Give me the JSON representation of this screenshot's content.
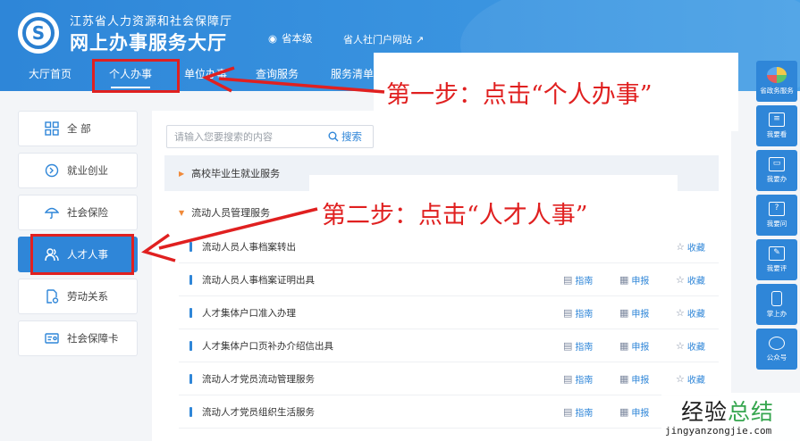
{
  "header": {
    "org_name": "江苏省人力资源和社会保障厅",
    "site_title": "网上办事服务大厅",
    "location": "省本级",
    "portal_link": "省人社门户网站"
  },
  "nav": {
    "items": [
      {
        "label": "大厅首页"
      },
      {
        "label": "个人办事"
      },
      {
        "label": "单位办事"
      },
      {
        "label": "查询服务"
      },
      {
        "label": "服务清单"
      }
    ]
  },
  "sidebar": {
    "items": [
      {
        "label": "全 部"
      },
      {
        "label": "就业创业"
      },
      {
        "label": "社会保险"
      },
      {
        "label": "人才人事"
      },
      {
        "label": "劳动关系"
      },
      {
        "label": "社会保障卡"
      }
    ]
  },
  "search": {
    "placeholder": "请输入您要搜索的内容",
    "button_label": "搜索"
  },
  "categories": [
    {
      "label": "高校毕业生就业服务"
    },
    {
      "label": "流动人员管理服务"
    }
  ],
  "services": [
    {
      "name": "流动人员人事档案转出",
      "fav": "收藏"
    },
    {
      "name": "流动人员人事档案证明出具",
      "guide": "指南",
      "report": "申报",
      "fav": "收藏"
    },
    {
      "name": "人才集体户口准入办理",
      "guide": "指南",
      "report": "申报",
      "fav": "收藏"
    },
    {
      "name": "人才集体户口页补办介绍信出具",
      "guide": "指南",
      "report": "申报",
      "fav": "收藏"
    },
    {
      "name": "流动人才党员流动管理服务",
      "guide": "指南",
      "report": "申报",
      "fav": "收藏"
    },
    {
      "name": "流动人才党员组织生活服务",
      "guide": "指南",
      "report": "申报"
    }
  ],
  "rightbar": {
    "items": [
      {
        "label": "省政务服务"
      },
      {
        "label": "我要看"
      },
      {
        "label": "我要办"
      },
      {
        "label": "我要问"
      },
      {
        "label": "我要评"
      },
      {
        "label": "掌上办"
      },
      {
        "label": "公众号"
      }
    ]
  },
  "annotations": {
    "step1": "第一步：点击“个人办事”",
    "step2": "第二步：点击“人才人事”",
    "color": "#e02020"
  },
  "watermark": {
    "title_black": "经验",
    "title_green": "总结",
    "url": "jingyanzongjie.com"
  },
  "colors": {
    "primary": "#2f86d8",
    "header": "#3a94e0",
    "accent_triangle": "#f08a3a"
  }
}
